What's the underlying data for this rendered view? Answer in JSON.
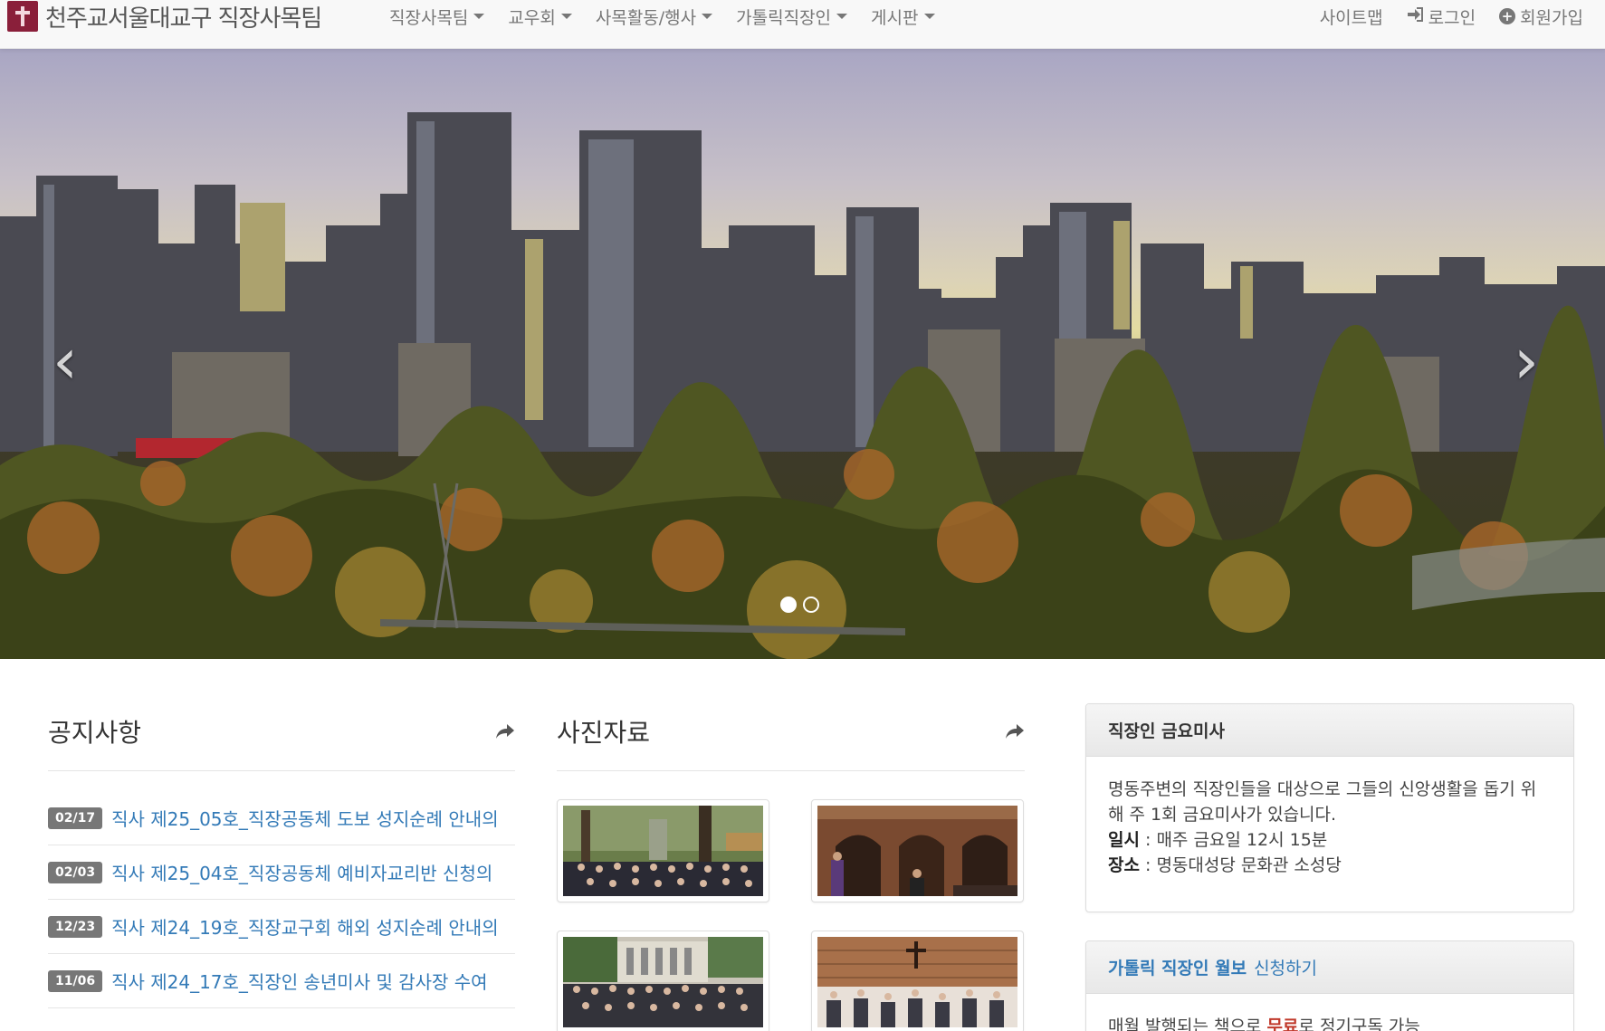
{
  "brand": {
    "title": "천주교서울대교구 직장사목팀"
  },
  "nav": {
    "items": [
      {
        "label": "직장사목팀"
      },
      {
        "label": "교우회"
      },
      {
        "label": "사목활동/행사"
      },
      {
        "label": "가톨릭직장인"
      },
      {
        "label": "게시판"
      }
    ],
    "sitemap": "사이트맵",
    "login": "로그인",
    "signup": "회원가입"
  },
  "carousel": {
    "prev_glyph": "‹",
    "next_glyph": "›",
    "slide_count": 2,
    "active_slide": 1
  },
  "notice": {
    "title": "공지사항",
    "items": [
      {
        "date": "02/17",
        "text": "직사 제25_05호_직장공동체 도보 성지순례 안내의"
      },
      {
        "date": "02/03",
        "text": "직사 제25_04호_직장공동체 예비자교리반 신청의"
      },
      {
        "date": "12/23",
        "text": "직사 제24_19호_직장교구회 해외 성지순례 안내의"
      },
      {
        "date": "11/06",
        "text": "직사 제24_17호_직장인 송년미사 및 감사장 수여"
      },
      {
        "date": "",
        "text": ""
      }
    ]
  },
  "photos": {
    "title": "사진자료"
  },
  "mass_panel": {
    "heading": "직장인 금요미사",
    "description": "명동주변의 직장인들을 대상으로 그들의 신앙생활을 돕기 위해 주 1회 금요미사가 있습니다.",
    "time_label": "일시",
    "time_value": " : 매주 금요일 12시 15분",
    "place_label": "장소",
    "place_value": " : 명동대성당 문화관 소성당"
  },
  "monthly_panel": {
    "heading_bold": "가톨릭 직장인 월보",
    "heading_rest": "신청하기",
    "body_pre": "매월 발행되는 책으로 ",
    "body_red": "무료",
    "body_post": "로 정기구독 가능"
  },
  "colors": {
    "link": "#337ab7",
    "badge": "#777777",
    "accent_red": "#c0392b",
    "logo": "#8a1f3a"
  }
}
